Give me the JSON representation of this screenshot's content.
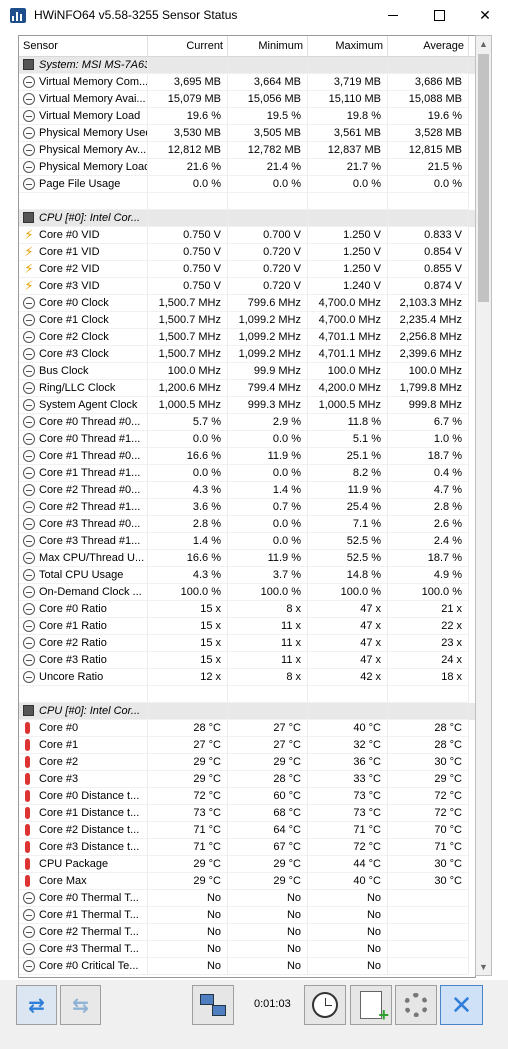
{
  "window": {
    "title": "HWiNFO64 v5.58-3255 Sensor Status"
  },
  "columns": [
    "Sensor",
    "Current",
    "Minimum",
    "Maximum",
    "Average"
  ],
  "rows": [
    {
      "type": "group",
      "icon": "chip-icon",
      "name": "System: MSI MS-7A63"
    },
    {
      "type": "data",
      "icon": "clock-icon",
      "name": "Virtual Memory Com...",
      "cur": "3,695 MB",
      "min": "3,664 MB",
      "max": "3,719 MB",
      "avg": "3,686 MB"
    },
    {
      "type": "data",
      "icon": "clock-icon",
      "name": "Virtual Memory Avai...",
      "cur": "15,079 MB",
      "min": "15,056 MB",
      "max": "15,110 MB",
      "avg": "15,088 MB"
    },
    {
      "type": "data",
      "icon": "clock-icon",
      "name": "Virtual Memory Load",
      "cur": "19.6 %",
      "min": "19.5 %",
      "max": "19.8 %",
      "avg": "19.6 %"
    },
    {
      "type": "data",
      "icon": "clock-icon",
      "name": "Physical Memory Used",
      "cur": "3,530 MB",
      "min": "3,505 MB",
      "max": "3,561 MB",
      "avg": "3,528 MB"
    },
    {
      "type": "data",
      "icon": "clock-icon",
      "name": "Physical Memory Av...",
      "cur": "12,812 MB",
      "min": "12,782 MB",
      "max": "12,837 MB",
      "avg": "12,815 MB"
    },
    {
      "type": "data",
      "icon": "clock-icon",
      "name": "Physical Memory Load",
      "cur": "21.6 %",
      "min": "21.4 %",
      "max": "21.7 %",
      "avg": "21.5 %"
    },
    {
      "type": "data",
      "icon": "clock-icon",
      "name": "Page File Usage",
      "cur": "0.0 %",
      "min": "0.0 %",
      "max": "0.0 %",
      "avg": "0.0 %"
    },
    {
      "type": "blank"
    },
    {
      "type": "group",
      "icon": "chip-icon",
      "name": "CPU [#0]: Intel Cor..."
    },
    {
      "type": "data",
      "icon": "voltage-icon",
      "name": "Core #0 VID",
      "cur": "0.750 V",
      "min": "0.700 V",
      "max": "1.250 V",
      "avg": "0.833 V"
    },
    {
      "type": "data",
      "icon": "voltage-icon",
      "name": "Core #1 VID",
      "cur": "0.750 V",
      "min": "0.720 V",
      "max": "1.250 V",
      "avg": "0.854 V"
    },
    {
      "type": "data",
      "icon": "voltage-icon",
      "name": "Core #2 VID",
      "cur": "0.750 V",
      "min": "0.720 V",
      "max": "1.250 V",
      "avg": "0.855 V"
    },
    {
      "type": "data",
      "icon": "voltage-icon",
      "name": "Core #3 VID",
      "cur": "0.750 V",
      "min": "0.720 V",
      "max": "1.240 V",
      "avg": "0.874 V"
    },
    {
      "type": "data",
      "icon": "clock-icon",
      "name": "Core #0 Clock",
      "cur": "1,500.7 MHz",
      "min": "799.6 MHz",
      "max": "4,700.0 MHz",
      "avg": "2,103.3 MHz"
    },
    {
      "type": "data",
      "icon": "clock-icon",
      "name": "Core #1 Clock",
      "cur": "1,500.7 MHz",
      "min": "1,099.2 MHz",
      "max": "4,700.0 MHz",
      "avg": "2,235.4 MHz"
    },
    {
      "type": "data",
      "icon": "clock-icon",
      "name": "Core #2 Clock",
      "cur": "1,500.7 MHz",
      "min": "1,099.2 MHz",
      "max": "4,701.1 MHz",
      "avg": "2,256.8 MHz"
    },
    {
      "type": "data",
      "icon": "clock-icon",
      "name": "Core #3 Clock",
      "cur": "1,500.7 MHz",
      "min": "1,099.2 MHz",
      "max": "4,701.1 MHz",
      "avg": "2,399.6 MHz"
    },
    {
      "type": "data",
      "icon": "clock-icon",
      "name": "Bus Clock",
      "cur": "100.0 MHz",
      "min": "99.9 MHz",
      "max": "100.0 MHz",
      "avg": "100.0 MHz"
    },
    {
      "type": "data",
      "icon": "clock-icon",
      "name": "Ring/LLC Clock",
      "cur": "1,200.6 MHz",
      "min": "799.4 MHz",
      "max": "4,200.0 MHz",
      "avg": "1,799.8 MHz"
    },
    {
      "type": "data",
      "icon": "clock-icon",
      "name": "System Agent Clock",
      "cur": "1,000.5 MHz",
      "min": "999.3 MHz",
      "max": "1,000.5 MHz",
      "avg": "999.8 MHz"
    },
    {
      "type": "data",
      "icon": "clock-icon",
      "name": "Core #0 Thread #0...",
      "cur": "5.7 %",
      "min": "2.9 %",
      "max": "11.8 %",
      "avg": "6.7 %"
    },
    {
      "type": "data",
      "icon": "clock-icon",
      "name": "Core #0 Thread #1...",
      "cur": "0.0 %",
      "min": "0.0 %",
      "max": "5.1 %",
      "avg": "1.0 %"
    },
    {
      "type": "data",
      "icon": "clock-icon",
      "name": "Core #1 Thread #0...",
      "cur": "16.6 %",
      "min": "11.9 %",
      "max": "25.1 %",
      "avg": "18.7 %"
    },
    {
      "type": "data",
      "icon": "clock-icon",
      "name": "Core #1 Thread #1...",
      "cur": "0.0 %",
      "min": "0.0 %",
      "max": "8.2 %",
      "avg": "0.4 %"
    },
    {
      "type": "data",
      "icon": "clock-icon",
      "name": "Core #2 Thread #0...",
      "cur": "4.3 %",
      "min": "1.4 %",
      "max": "11.9 %",
      "avg": "4.7 %"
    },
    {
      "type": "data",
      "icon": "clock-icon",
      "name": "Core #2 Thread #1...",
      "cur": "3.6 %",
      "min": "0.7 %",
      "max": "25.4 %",
      "avg": "2.8 %"
    },
    {
      "type": "data",
      "icon": "clock-icon",
      "name": "Core #3 Thread #0...",
      "cur": "2.8 %",
      "min": "0.0 %",
      "max": "7.1 %",
      "avg": "2.6 %"
    },
    {
      "type": "data",
      "icon": "clock-icon",
      "name": "Core #3 Thread #1...",
      "cur": "1.4 %",
      "min": "0.0 %",
      "max": "52.5 %",
      "avg": "2.4 %"
    },
    {
      "type": "data",
      "icon": "clock-icon",
      "name": "Max CPU/Thread U...",
      "cur": "16.6 %",
      "min": "11.9 %",
      "max": "52.5 %",
      "avg": "18.7 %"
    },
    {
      "type": "data",
      "icon": "clock-icon",
      "name": "Total CPU Usage",
      "cur": "4.3 %",
      "min": "3.7 %",
      "max": "14.8 %",
      "avg": "4.9 %"
    },
    {
      "type": "data",
      "icon": "clock-icon",
      "name": "On-Demand Clock ...",
      "cur": "100.0 %",
      "min": "100.0 %",
      "max": "100.0 %",
      "avg": "100.0 %"
    },
    {
      "type": "data",
      "icon": "clock-icon",
      "name": "Core #0 Ratio",
      "cur": "15 x",
      "min": "8 x",
      "max": "47 x",
      "avg": "21 x"
    },
    {
      "type": "data",
      "icon": "clock-icon",
      "name": "Core #1 Ratio",
      "cur": "15 x",
      "min": "11 x",
      "max": "47 x",
      "avg": "22 x"
    },
    {
      "type": "data",
      "icon": "clock-icon",
      "name": "Core #2 Ratio",
      "cur": "15 x",
      "min": "11 x",
      "max": "47 x",
      "avg": "23 x"
    },
    {
      "type": "data",
      "icon": "clock-icon",
      "name": "Core #3 Ratio",
      "cur": "15 x",
      "min": "11 x",
      "max": "47 x",
      "avg": "24 x"
    },
    {
      "type": "data",
      "icon": "clock-icon",
      "name": "Uncore Ratio",
      "cur": "12 x",
      "min": "8 x",
      "max": "42 x",
      "avg": "18 x"
    },
    {
      "type": "blank"
    },
    {
      "type": "group",
      "icon": "chip-icon",
      "name": "CPU [#0]: Intel Cor..."
    },
    {
      "type": "data",
      "icon": "thermometer-icon",
      "name": "Core #0",
      "cur": "28 °C",
      "min": "27 °C",
      "max": "40 °C",
      "avg": "28 °C"
    },
    {
      "type": "data",
      "icon": "thermometer-icon",
      "name": "Core #1",
      "cur": "27 °C",
      "min": "27 °C",
      "max": "32 °C",
      "avg": "28 °C"
    },
    {
      "type": "data",
      "icon": "thermometer-icon",
      "name": "Core #2",
      "cur": "29 °C",
      "min": "29 °C",
      "max": "36 °C",
      "avg": "30 °C"
    },
    {
      "type": "data",
      "icon": "thermometer-icon",
      "name": "Core #3",
      "cur": "29 °C",
      "min": "28 °C",
      "max": "33 °C",
      "avg": "29 °C"
    },
    {
      "type": "data",
      "icon": "thermometer-icon",
      "name": "Core #0 Distance t...",
      "cur": "72 °C",
      "min": "60 °C",
      "max": "73 °C",
      "avg": "72 °C"
    },
    {
      "type": "data",
      "icon": "thermometer-icon",
      "name": "Core #1 Distance t...",
      "cur": "73 °C",
      "min": "68 °C",
      "max": "73 °C",
      "avg": "72 °C"
    },
    {
      "type": "data",
      "icon": "thermometer-icon",
      "name": "Core #2 Distance t...",
      "cur": "71 °C",
      "min": "64 °C",
      "max": "71 °C",
      "avg": "70 °C"
    },
    {
      "type": "data",
      "icon": "thermometer-icon",
      "name": "Core #3 Distance t...",
      "cur": "71 °C",
      "min": "67 °C",
      "max": "72 °C",
      "avg": "71 °C"
    },
    {
      "type": "data",
      "icon": "thermometer-icon",
      "name": "CPU Package",
      "cur": "29 °C",
      "min": "29 °C",
      "max": "44 °C",
      "avg": "30 °C"
    },
    {
      "type": "data",
      "icon": "thermometer-icon",
      "name": "Core Max",
      "cur": "29 °C",
      "min": "29 °C",
      "max": "40 °C",
      "avg": "30 °C"
    },
    {
      "type": "data",
      "icon": "clock-icon",
      "name": "Core #0 Thermal T...",
      "cur": "No",
      "min": "No",
      "max": "No",
      "avg": ""
    },
    {
      "type": "data",
      "icon": "clock-icon",
      "name": "Core #1 Thermal T...",
      "cur": "No",
      "min": "No",
      "max": "No",
      "avg": ""
    },
    {
      "type": "data",
      "icon": "clock-icon",
      "name": "Core #2 Thermal T...",
      "cur": "No",
      "min": "No",
      "max": "No",
      "avg": ""
    },
    {
      "type": "data",
      "icon": "clock-icon",
      "name": "Core #3 Thermal T...",
      "cur": "No",
      "min": "No",
      "max": "No",
      "avg": ""
    },
    {
      "type": "data",
      "icon": "clock-icon",
      "name": "Core #0 Critical Te...",
      "cur": "No",
      "min": "No",
      "max": "No",
      "avg": ""
    }
  ],
  "scrollbar": {
    "position_fraction": 0.02,
    "visible_fraction": 0.26
  },
  "toolbar": {
    "timer": "0:01:03"
  },
  "colors": {
    "accent": "#2f7ed8",
    "selection": "#e8e8e8",
    "volt": "#e0a000",
    "thermo": "#d33333"
  }
}
